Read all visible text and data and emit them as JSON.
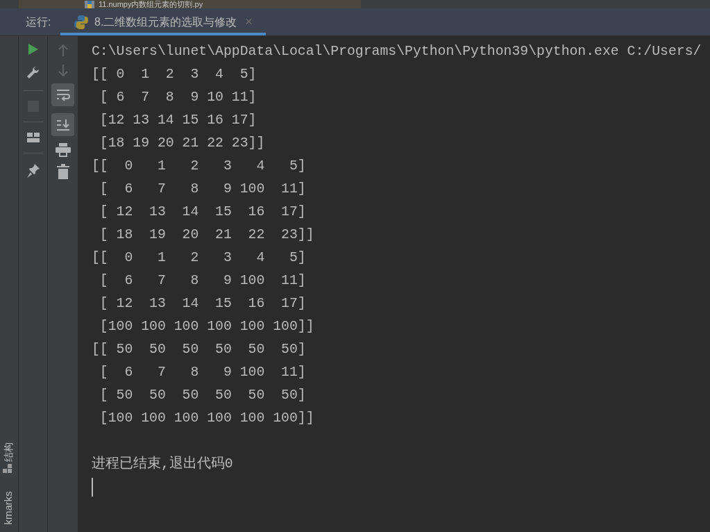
{
  "editor_tab": {
    "title": "11.numpy内数组元素的切割.py"
  },
  "run_panel": {
    "label": "运行:",
    "tabs": [
      {
        "title": "8.二维数组元素的选取与修改",
        "selected": true,
        "close": "×"
      }
    ]
  },
  "toolbar": {
    "stop_disabled": true,
    "soft_wrap_on": true,
    "scroll_to_end_on": true
  },
  "console": {
    "lines": [
      "C:\\Users\\lunet\\AppData\\Local\\Programs\\Python\\Python39\\python.exe C:/Users/",
      "[[ 0  1  2  3  4  5]",
      " [ 6  7  8  9 10 11]",
      " [12 13 14 15 16 17]",
      " [18 19 20 21 22 23]]",
      "[[  0   1   2   3   4   5]",
      " [  6   7   8   9 100  11]",
      " [ 12  13  14  15  16  17]",
      " [ 18  19  20  21  22  23]]",
      "[[  0   1   2   3   4   5]",
      " [  6   7   8   9 100  11]",
      " [ 12  13  14  15  16  17]",
      " [100 100 100 100 100 100]]",
      "[[ 50  50  50  50  50  50]",
      " [  6   7   8   9 100  11]",
      " [ 50  50  50  50  50  50]",
      " [100 100 100 100 100 100]]"
    ],
    "exit_message": "进程已结束,退出代码0"
  },
  "side_tabs": [
    {
      "label": "结构"
    },
    {
      "label": "kmarks"
    }
  ]
}
